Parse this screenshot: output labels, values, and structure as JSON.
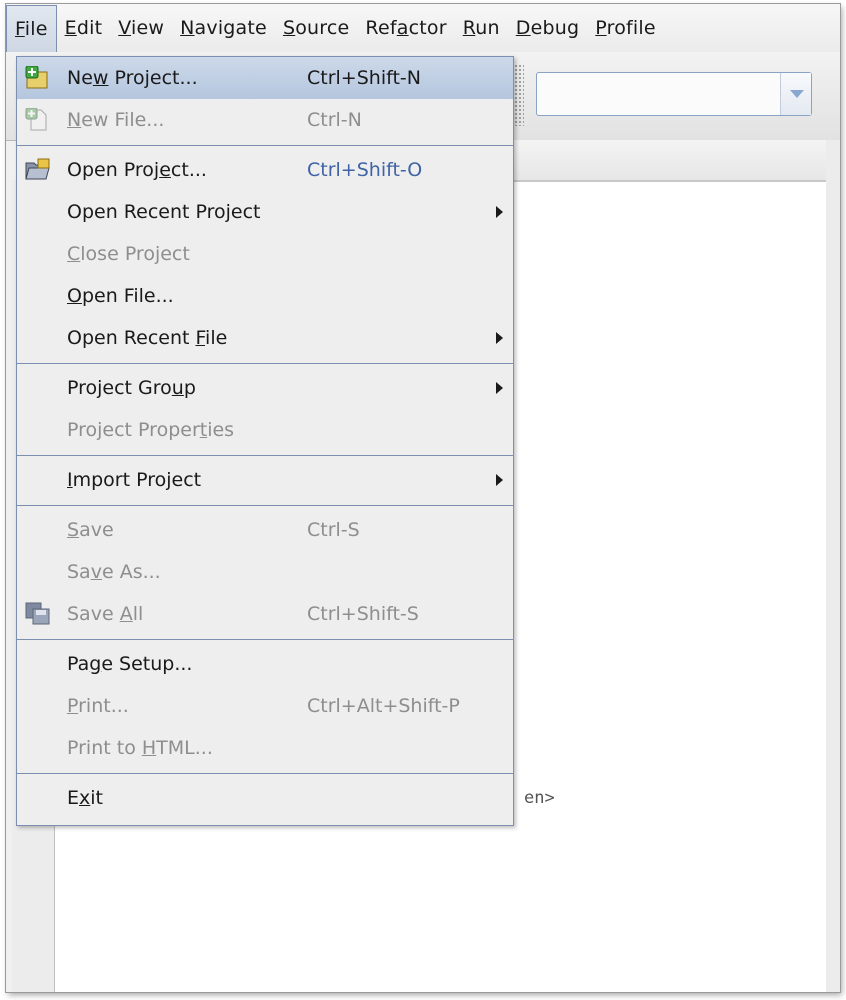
{
  "menubar": {
    "items": [
      {
        "label": "File",
        "u": "F",
        "rest": "ile",
        "active": true
      },
      {
        "label": "Edit",
        "u": "E",
        "rest": "dit"
      },
      {
        "label": "View",
        "u": "V",
        "rest": "iew"
      },
      {
        "label": "Navigate",
        "u": "N",
        "rest": "avigate"
      },
      {
        "label": "Source",
        "u": "S",
        "rest": "ource"
      },
      {
        "label": "Refactor",
        "pre": "Ref",
        "u": "a",
        "rest": "ctor"
      },
      {
        "label": "Run",
        "u": "R",
        "rest": "un"
      },
      {
        "label": "Debug",
        "u": "D",
        "rest": "ebug"
      },
      {
        "label": "Profile",
        "u": "P",
        "rest": "rofile"
      }
    ]
  },
  "file_menu": {
    "new_project": {
      "pre": "Ne",
      "u": "w",
      "rest": " Project...",
      "shortcut": "Ctrl+Shift-N"
    },
    "new_file": {
      "pre": "",
      "u": "N",
      "rest": "ew File...",
      "shortcut": "Ctrl-N"
    },
    "open_project": {
      "pre": "Open Proj",
      "u": "e",
      "rest": "ct...",
      "shortcut": "Ctrl+Shift-O"
    },
    "open_recent_project": {
      "label": "Open Recent Project"
    },
    "close_project": {
      "pre": "",
      "u": "C",
      "rest": "lose Project"
    },
    "open_file": {
      "pre": "",
      "u": "O",
      "rest": "pen File..."
    },
    "open_recent_file": {
      "pre": "Open Recent ",
      "u": "F",
      "rest": "ile"
    },
    "project_group": {
      "pre": "Project Gro",
      "u": "u",
      "rest": "p"
    },
    "project_properties": {
      "pre": "Project Proper",
      "u": "t",
      "rest": "ies"
    },
    "import_project": {
      "pre": "",
      "u": "I",
      "rest": "mport Project"
    },
    "save": {
      "pre": "",
      "u": "S",
      "rest": "ave",
      "shortcut": "Ctrl-S"
    },
    "save_as": {
      "pre": "Sa",
      "u": "v",
      "rest": "e As..."
    },
    "save_all": {
      "pre": "Save ",
      "u": "A",
      "rest": "ll",
      "shortcut": "Ctrl+Shift-S"
    },
    "page_setup": {
      "pre": "Pa",
      "u": "g",
      "rest": "e Setup..."
    },
    "print": {
      "pre": "",
      "u": "P",
      "rest": "rint...",
      "shortcut": "Ctrl+Alt+Shift-P"
    },
    "print_to_html": {
      "pre": "Print to ",
      "u": "H",
      "rest": "TML..."
    },
    "exit": {
      "pre": "E",
      "u": "x",
      "rest": "it"
    }
  },
  "editor": {
    "partial_text": "en>"
  },
  "colors": {
    "highlight": "#b4c6de",
    "border": "#7d8fb0",
    "shortcut_blue": "#3f63a6",
    "disabled": "#8e8e8e"
  }
}
